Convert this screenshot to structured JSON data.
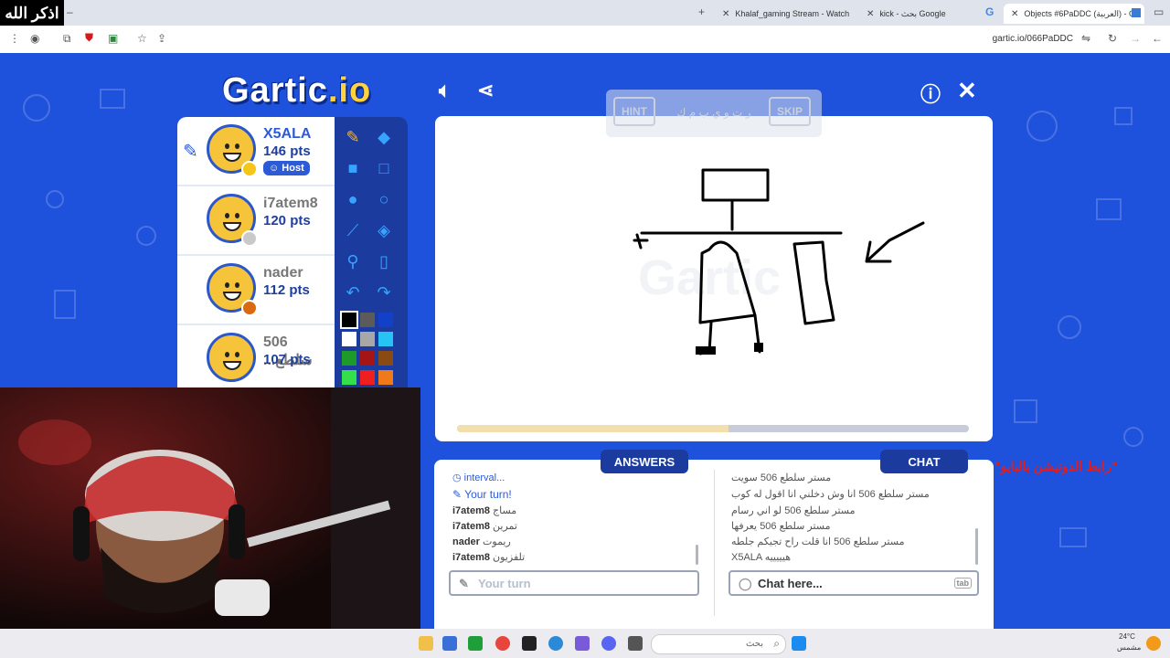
{
  "overlay_text": "اذكر الله",
  "browser": {
    "tabs": [
      {
        "label": "Khalaf_gaming Stream - Watch"
      },
      {
        "label": "kick - بحث Google"
      },
      {
        "label": "Objects #6PaDDC (العربية) - Ga"
      }
    ],
    "url": "gartic.io/066PaDDC"
  },
  "game": {
    "logo_main": "Gartic",
    "logo_io": ".io",
    "hint_label": "HINT",
    "skip_label": "SKIP",
    "hint_word": "ر ت و ي ب م ك",
    "progress": 0.53,
    "players": [
      {
        "name": "X5ALA",
        "points": "146 pts",
        "badge": "Host",
        "status_color": "#f5c518",
        "is_drawing": true
      },
      {
        "name": "i7atem8",
        "points": "120 pts",
        "status_color": "#c9c9c9"
      },
      {
        "name": "nader",
        "points": "112 pts",
        "status_color": "#d96a10"
      },
      {
        "name": "506 ...سلطع",
        "points": "107 pts",
        "status_color": ""
      }
    ],
    "palette": [
      "#000000",
      "#5b5b5b",
      "#1340c8",
      "#ffffff",
      "#a7a7a7",
      "#28c3f5",
      "#1e9a2b",
      "#a61515",
      "#8a4b13",
      "#34e04a",
      "#f01f1f",
      "#f07a1a"
    ]
  },
  "answers": {
    "tab_label": "ANSWERS",
    "entries": [
      {
        "user": "",
        "text": "interval...",
        "type": "system"
      },
      {
        "user": "",
        "text": "Your turn!",
        "type": "turn"
      },
      {
        "user": "i7atem8",
        "text": "مساج"
      },
      {
        "user": "i7atem8",
        "text": "تمرين"
      },
      {
        "user": "nader",
        "text": "ريموت"
      },
      {
        "user": "i7atem8",
        "text": "تلفزيون"
      }
    ],
    "input_placeholder": "Your turn"
  },
  "chat": {
    "tab_label": "CHAT",
    "messages": [
      {
        "text": "مستر سلطع 506 سويت"
      },
      {
        "text": "مستر سلطع 506 انا وش دخلني انا اقول له كوب"
      },
      {
        "text": "مستر سلطع 506 لو اني رسام"
      },
      {
        "text": "مستر سلطع 506 يعرفها"
      },
      {
        "text": "مستر سلطع 506 انا قلت راح تجيكم جلطه"
      },
      {
        "text": "X5ALA هيييييه"
      }
    ],
    "input_placeholder": "Chat here...",
    "tab_key": "tab"
  },
  "side_text": "\"رابط الدونيشن بالبايو\"",
  "taskbar": {
    "search_placeholder": "بحث",
    "temperature": "24°C",
    "weather": "مشمس"
  }
}
